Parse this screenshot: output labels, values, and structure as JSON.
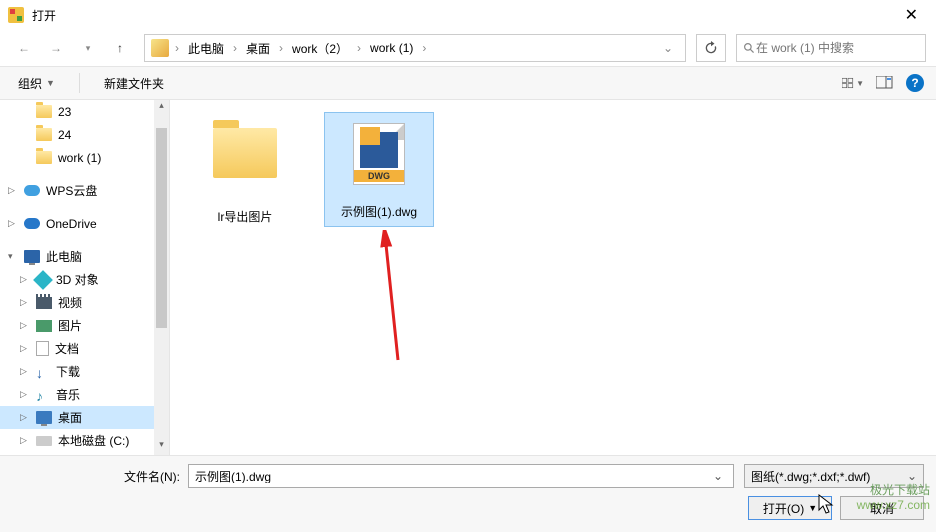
{
  "window": {
    "title": "打开"
  },
  "breadcrumb": {
    "items": [
      "此电脑",
      "桌面",
      "work（2）",
      "work (1)"
    ]
  },
  "search": {
    "placeholder": "在 work (1) 中搜索"
  },
  "toolbar": {
    "organize": "组织",
    "new_folder": "新建文件夹"
  },
  "tree": {
    "item0": "23",
    "item1": "24",
    "item2": "work (1)",
    "wps": "WPS云盘",
    "onedrive": "OneDrive",
    "thispc": "此电脑",
    "obj3d": "3D 对象",
    "video": "视频",
    "image": "图片",
    "docs": "文档",
    "downloads": "下载",
    "music": "音乐",
    "desktop": "桌面",
    "localdisk": "本地磁盘 (C:)"
  },
  "files": {
    "folder1": "lr导出图片",
    "file1": "示例图(1).dwg",
    "dwg_label": "DWG"
  },
  "bottom": {
    "filename_label": "文件名(N):",
    "filename_value": "示例图(1).dwg",
    "filter": "图纸(*.dwg;*.dxf;*.dwf)",
    "open": "打开(O)",
    "cancel": "取消"
  },
  "watermark": {
    "line1": "极光下载站",
    "line2": "www.xz7.com"
  }
}
